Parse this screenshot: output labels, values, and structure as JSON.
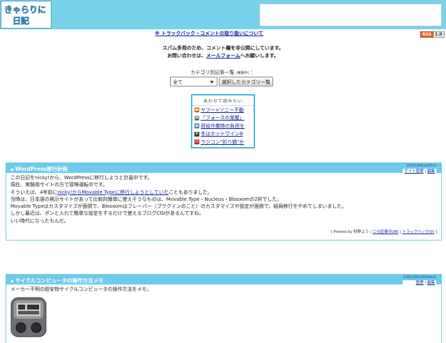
{
  "header": {
    "logo_text": "きゃらりに日記",
    "colors": {
      "header_bg": "#79d2ec",
      "accent": "#6ccbec",
      "link": "#1020a0"
    }
  },
  "topbar": {
    "trackback_link": "※ トラックバック・コメントの取り扱いについて",
    "rss_label": "RSS",
    "rss_version": "1.0"
  },
  "notice": {
    "line1": "スパム多発のため、コメント欄を非公開にしています。",
    "line2_prefix": "お問い合わせは、",
    "line2_link": "メールフォーム",
    "line2_suffix": "へお願いします。"
  },
  "category": {
    "label": "カテゴリ別記事一覧",
    "label_small": "(実験中)",
    "label_suffix": "：",
    "selected": "全て",
    "button": "選択したカテゴリー覧"
  },
  "related": {
    "title": "あわせて読みたい",
    "items": [
      {
        "icon": "rss-icon",
        "text": "ヤフー×ソニー不動"
      },
      {
        "icon": "g-icon",
        "text": "「フォースの覚醒」"
      },
      {
        "icon": "calendar-icon",
        "text": "荷役作業時の負担を"
      },
      {
        "icon": "b-icon",
        "text": "冬はホットワイン8"
      },
      {
        "icon": "it-icon",
        "text": "ラジコン\"折り鶴\"か"
      }
    ]
  },
  "entries": [
    {
      "title": "WordPress移行計画",
      "date": "2007/09/14(Fri)",
      "link1": "サイト管理",
      "link2": "編集",
      "body_lines": [
        "この日記をnicky!から、WordPressに移行しようと計画中です。",
        "現在、実験用サイトの方で冒険運転中です。"
      ],
      "line3_prefix": "そういえば、4年前に",
      "line3_link": "nicky!からMovable Typeに移行しようとしていた",
      "line3_suffix": "こともありました。",
      "body_lines2": [
        "当時は、日本語の掲示サイトがあって比較的簡単に使えそうなものは、Movable Type・Nucleus・Blosxomの2択でした。",
        "Movable Typeはカスタマイズが面倒で、Blosxomはフレーバー（プラグインのこと）のカスタマイズや設定が面倒で、結局移行をやめてしまいました。",
        "しかし最近は、ポンと入れて簡単な設定をするだけで使えるブログCGIがあるんですね。",
        "いい時代になったもんだ。"
      ],
      "foot_prefix": "[ Posted by 秋野よう | ",
      "foot_link1": "この記事のURI",
      "foot_sep": " | ",
      "foot_link2": "トラックバック(0)",
      "foot_suffix": " ]"
    },
    {
      "title": "サイクルコンピュータの操作方法メモ",
      "date": "2007/08/29(Wed)",
      "link1": "管理",
      "link2": "編集",
      "body_lines": [
        "メーカー不明の超安物サイクルコンピュータの操作方法をメモ。"
      ]
    }
  ]
}
